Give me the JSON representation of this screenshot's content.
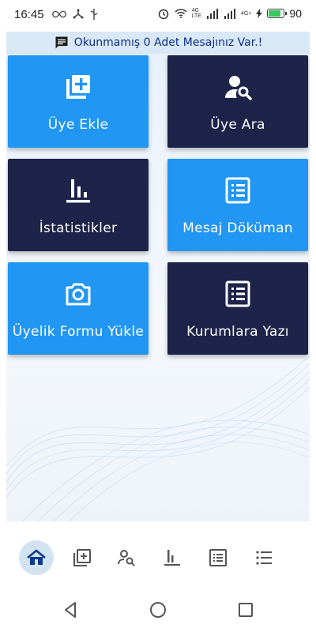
{
  "status_bar": {
    "time": "16:45",
    "battery_percent": "90",
    "battery_level": 0.9,
    "network_label_top": "4G",
    "network_label_bottom": "LTE",
    "network_label_2": "4G+",
    "icons": [
      "infinity-icon",
      "usb-icon",
      "alarm-icon",
      "wifi-icon",
      "signal-icon",
      "signal-icon",
      "bolt-icon",
      "battery-icon"
    ]
  },
  "message_banner": {
    "text": "Okunmamış 0 Adet Mesajınız Var.!",
    "icon": "message-icon"
  },
  "tiles": [
    {
      "label": "Üye Ekle",
      "icon": "add-library-icon",
      "color": "#2196f3"
    },
    {
      "label": "Üye Ara",
      "icon": "person-search-icon",
      "color": "#1d2349"
    },
    {
      "label": "İstatistikler",
      "icon": "bar-chart-icon",
      "color": "#1d2349"
    },
    {
      "label": "Mesaj Döküman",
      "icon": "list-alt-icon",
      "color": "#2196f3"
    },
    {
      "label": "Üyelik Formu Yükle",
      "icon": "camera-icon",
      "color": "#2196f3"
    },
    {
      "label": "Kurumlara Yazı",
      "icon": "list-alt-icon",
      "color": "#1d2349"
    }
  ],
  "bottom_nav": {
    "items": [
      {
        "name": "home",
        "icon": "home-icon",
        "active": true
      },
      {
        "name": "add-member",
        "icon": "add-library-icon",
        "active": false
      },
      {
        "name": "search-member",
        "icon": "person-search-icon",
        "active": false
      },
      {
        "name": "statistics",
        "icon": "bar-chart-icon",
        "active": false
      },
      {
        "name": "documents",
        "icon": "list-alt-icon",
        "active": false
      },
      {
        "name": "list",
        "icon": "list-icon",
        "active": false
      }
    ],
    "active_bg": "#d3e3f2",
    "accent": "#0e3a8c"
  },
  "system_nav": [
    "back-icon",
    "home-circle-icon",
    "recents-icon"
  ]
}
